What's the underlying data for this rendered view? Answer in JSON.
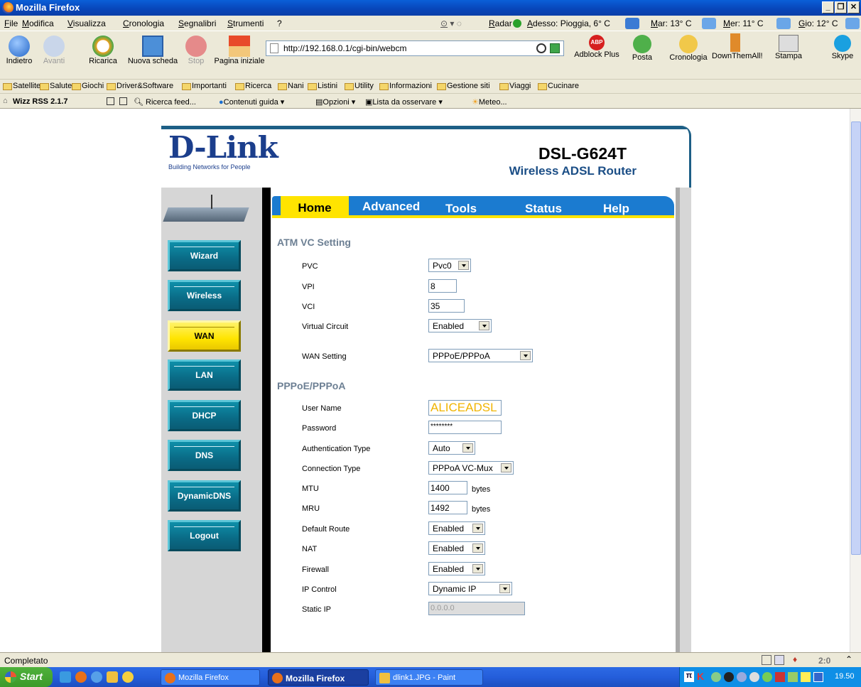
{
  "window": {
    "title": "Mozilla Firefox"
  },
  "menu": [
    "File",
    "Modifica",
    "Visualizza",
    "Cronologia",
    "Segnalibri",
    "Strumenti",
    "?"
  ],
  "weather": {
    "radar": "Radar",
    "now": "Adesso: Pioggia, 6° C",
    "tue": "Mar: 13° C",
    "wed": "Mer: 11° C",
    "thu": "Gio: 12° C"
  },
  "navbar": {
    "back": "Indietro",
    "forward": "Avanti",
    "reload": "Ricarica",
    "newtab": "Nuova scheda",
    "stop": "Stop",
    "home": "Pagina iniziale",
    "url": "http://192.168.0.1/cgi-bin/webcm",
    "adblock": "Adblock Plus",
    "mail": "Posta",
    "history": "Cronologia",
    "dta": "DownThemAll!",
    "print": "Stampa",
    "skype": "Skype"
  },
  "bookmarks": [
    "Satellite",
    "Salute",
    "Giochi",
    "Driver&Software",
    "Importanti",
    "Ricerca",
    "Nani",
    "Listini",
    "Utility",
    "Informazioni",
    "Gestione siti",
    "Viaggi",
    "Cucinare"
  ],
  "rssbar": {
    "name": "Wizz RSS 2.1.7",
    "search": "Ricerca feed...",
    "guide": "Contenuti guida",
    "options": "Opzioni",
    "watch": "Lista da osservare",
    "weather": "Meteo..."
  },
  "router": {
    "logo": "D-Link",
    "slogan": "Building Networks for People",
    "model": "DSL-G624T",
    "subtitle": "Wireless ADSL Router",
    "tabs": [
      "Home",
      "Advanced",
      "Tools",
      "Status",
      "Help"
    ],
    "active_tab": "Home",
    "sidebar": [
      "Wizard",
      "Wireless",
      "WAN",
      "LAN",
      "DHCP",
      "DNS",
      "DynamicDNS",
      "Logout"
    ],
    "active_sidebar": "WAN",
    "atm": {
      "title": "ATM VC Setting",
      "pvc_label": "PVC",
      "pvc_value": "Pvc0",
      "vpi_label": "VPI",
      "vpi_value": "8",
      "vci_label": "VCI",
      "vci_value": "35",
      "vc_label": "Virtual Circuit",
      "vc_value": "Enabled",
      "wan_label": "WAN Setting",
      "wan_value": "PPPoE/PPPoA"
    },
    "ppp": {
      "title": "PPPoE/PPPoA",
      "user_label": "User Name",
      "user_value": "ALICEADSL",
      "pass_label": "Password",
      "pass_value": "********",
      "auth_label": "Authentication Type",
      "auth_value": "Auto",
      "conn_label": "Connection Type",
      "conn_value": "PPPoA VC-Mux",
      "mtu_label": "MTU",
      "mtu_value": "1400",
      "mtu_unit": "bytes",
      "mru_label": "MRU",
      "mru_value": "1492",
      "mru_unit": "bytes",
      "route_label": "Default Route",
      "route_value": "Enabled",
      "nat_label": "NAT",
      "nat_value": "Enabled",
      "fw_label": "Firewall",
      "fw_value": "Enabled",
      "ipc_label": "IP Control",
      "ipc_value": "Dynamic IP",
      "sip_label": "Static IP",
      "sip_value": "0.0.0.0"
    }
  },
  "status": {
    "text": "Completato",
    "counter": "2:0"
  },
  "taskbar": {
    "start": "Start",
    "tasks": [
      "Mozilla Firefox",
      "Mozilla Firefox",
      "dlink1.JPG - Paint"
    ],
    "clock": "19.50"
  },
  "colors": {
    "accent": "#ffe400",
    "dlink_blue": "#1b3e8c",
    "tab_blue": "#1b7bd0",
    "button_teal": "#0a6b86"
  }
}
